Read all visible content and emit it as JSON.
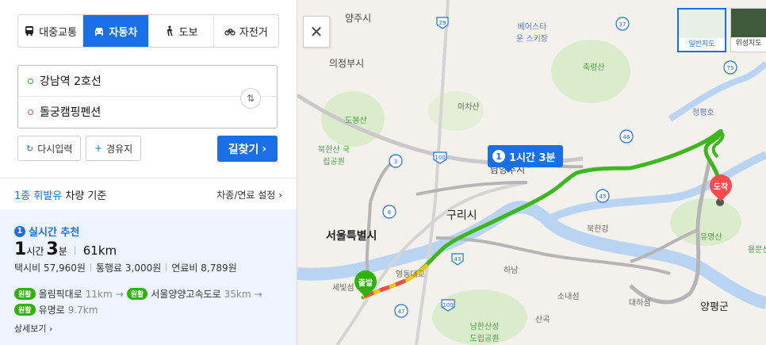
{
  "modes": [
    {
      "label": "대중교통",
      "icon": "bus-icon",
      "active": false
    },
    {
      "label": "자동차",
      "icon": "car-icon",
      "active": true
    },
    {
      "label": "도보",
      "icon": "walk-icon",
      "active": false
    },
    {
      "label": "자전거",
      "icon": "bicycle-icon",
      "active": false
    }
  ],
  "route": {
    "origin": "강남역 2호선",
    "destination": "돌궁캠핑펜션"
  },
  "actions": {
    "reset_label": "다시입력",
    "waypoint_label": "경유지",
    "search_label": "길찾기"
  },
  "fuel": {
    "type_label": "1종 휘발유",
    "suffix": " 차량 기준",
    "settings_label": "차종/연료 설정"
  },
  "result": {
    "rank": "1",
    "recommend_label": "실시간 추천",
    "hours": "1",
    "hours_unit": "시간",
    "minutes": "3",
    "minutes_unit": "분",
    "distance": "61km",
    "taxi": "택시비 57,960원",
    "toll": "통행료 3,000원",
    "fuel_cost": "연료비 8,789원",
    "roads_line1": [
      {
        "badge": "원활",
        "name": "올림픽대로",
        "km": "11km"
      },
      {
        "badge": "원활",
        "name": "서울양양고속도로",
        "km": "35km"
      }
    ],
    "roads_line2": [
      {
        "badge": "원활",
        "name": "유명로",
        "km": "9.7km"
      }
    ],
    "detail_label": "상세보기"
  },
  "map": {
    "callout_rank": "1",
    "callout_text": "1시간 3분",
    "start_label": "출발",
    "end_label": "도착",
    "maptypes": [
      {
        "label": "일반지도",
        "selected": true
      },
      {
        "label": "위성지도",
        "selected": false
      }
    ],
    "places": {
      "yangju": "양주시",
      "uijeongbu": "의정부시",
      "seoul": "서울특별시",
      "guri": "구리시",
      "namyangju": "남양주시",
      "yangpyeong": "양평군",
      "hanam": "하남",
      "sonaeseom": "소내섬",
      "daehaseom": "대하섬",
      "bukhangang": "북한강",
      "achasan": "아차산",
      "chukryeongsan": "축령산",
      "dobongsan": "도봉산",
      "bukhansan": "북한산 국립공원",
      "namhansanseong": "남한산성 도립공원",
      "yumyeongsan": "유명산",
      "yongmunsan": "용문산",
      "cheongpyeongho": "청평호",
      "bearstown": "베어스타운 스키장",
      "yeongdong": "영동대교",
      "sebitseom": "세빛섬",
      "sangok": "산곡",
      "bukhan_river": "북한강"
    },
    "highways": [
      "29",
      "37",
      "75",
      "46",
      "100",
      "3",
      "6",
      "43",
      "45",
      "47",
      "100"
    ]
  }
}
